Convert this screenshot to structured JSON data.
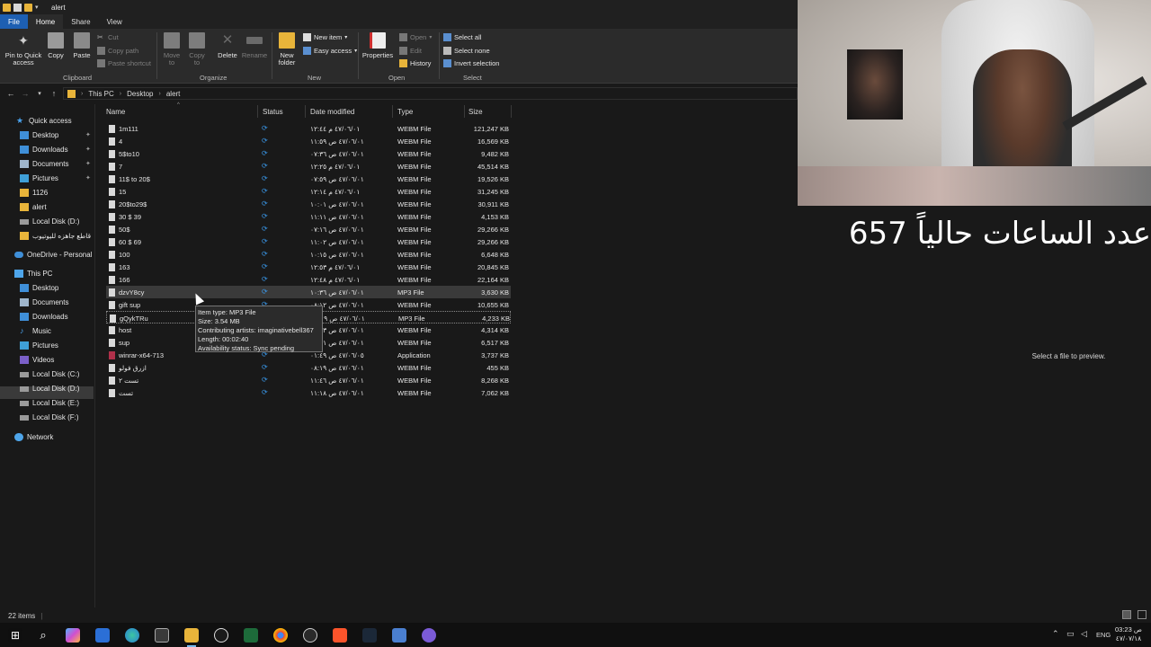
{
  "window": {
    "title": "alert"
  },
  "tabs": [
    "File",
    "Home",
    "Share",
    "View"
  ],
  "ribbon": {
    "clipboard": {
      "pin": "Pin to Quick access",
      "copy": "Copy",
      "paste": "Paste",
      "cut": "Cut",
      "copy_path": "Copy path",
      "paste_shortcut": "Paste shortcut",
      "group": "Clipboard"
    },
    "organize": {
      "move_to": "Move to",
      "copy_to": "Copy to",
      "delete": "Delete",
      "rename": "Rename",
      "group": "Organize"
    },
    "new": {
      "new_folder": "New folder",
      "new_item": "New item",
      "easy_access": "Easy access",
      "group": "New"
    },
    "open": {
      "properties": "Properties",
      "open": "Open",
      "edit": "Edit",
      "history": "History",
      "group": "Open"
    },
    "select": {
      "select_all": "Select all",
      "select_none": "Select none",
      "invert": "Invert selection",
      "group": "Select"
    }
  },
  "breadcrumbs": [
    "This PC",
    "Desktop",
    "alert"
  ],
  "nav": {
    "quick_access": "Quick access",
    "quick_items": [
      "Desktop",
      "Downloads",
      "Documents",
      "Pictures",
      "1126",
      "alert",
      "Local Disk (D:)",
      "قاطع جاهزه لليوتيوب"
    ],
    "onedrive": "OneDrive - Personal",
    "this_pc": "This PC",
    "pc_items": [
      "Desktop",
      "Documents",
      "Downloads",
      "Music",
      "Pictures",
      "Videos",
      "Local Disk (C:)",
      "Local Disk (D:)",
      "Local Disk (E:)",
      "Local Disk (F:)"
    ],
    "network": "Network"
  },
  "columns": {
    "name": "Name",
    "status": "Status",
    "date": "Date modified",
    "type": "Type",
    "size": "Size"
  },
  "files": [
    {
      "name": "1m111",
      "date": "٤٧/٠٦/٠١ م ١٢:٤٤",
      "type": "WEBM File",
      "size": "121,247 KB"
    },
    {
      "name": "4",
      "date": "٤٧/٠٦/٠١ ص ١١:٥٩",
      "type": "WEBM File",
      "size": "16,569 KB"
    },
    {
      "name": "5$to10",
      "date": "٤٧/٠٦/٠١ ص ٠٧:٣٦",
      "type": "WEBM File",
      "size": "9,482 KB"
    },
    {
      "name": "7",
      "date": "٤٧/٠٦/٠١ م ١٢:٢٥",
      "type": "WEBM File",
      "size": "45,514 KB"
    },
    {
      "name": "11$ to 20$",
      "date": "٤٧/٠٦/٠١ ص ٠٧:٥٩",
      "type": "WEBM File",
      "size": "19,526 KB"
    },
    {
      "name": "15",
      "date": "٤٧/٠٦/٠١ م ١٢:١٤",
      "type": "WEBM File",
      "size": "31,245 KB"
    },
    {
      "name": "20$to29$",
      "date": "٤٧/٠٦/٠١ ص ١٠:٠١",
      "type": "WEBM File",
      "size": "30,911 KB"
    },
    {
      "name": "30 $ 39",
      "date": "٤٧/٠٦/٠١ ص ١١:١١",
      "type": "WEBM File",
      "size": "4,153 KB"
    },
    {
      "name": "50$",
      "date": "٤٧/٠٦/٠١ ص ٠٧:١٦",
      "type": "WEBM File",
      "size": "29,266 KB"
    },
    {
      "name": "60 $ 69",
      "date": "٤٧/٠٦/٠١ ص ١١:٠٢",
      "type": "WEBM File",
      "size": "29,266 KB"
    },
    {
      "name": "100",
      "date": "٤٧/٠٦/٠١ ص ١٠:١٥",
      "type": "WEBM File",
      "size": "6,648 KB"
    },
    {
      "name": "163",
      "date": "٤٧/٠٦/٠١ م ١٢:٥٣",
      "type": "WEBM File",
      "size": "20,845 KB"
    },
    {
      "name": "166",
      "date": "٤٧/٠٦/٠١ م ١٢:٤٨",
      "type": "WEBM File",
      "size": "22,164 KB"
    },
    {
      "name": "dzvY8cy",
      "date": "٤٧/٠٦/٠١ ص ١٠:٣٦",
      "type": "MP3 File",
      "size": "3,630 KB"
    },
    {
      "name": "gift sup",
      "date": "٤٧/٠٦/٠١ ص ٠٨:١٢",
      "type": "WEBM File",
      "size": "10,655 KB"
    },
    {
      "name": "gQykTRu",
      "date": "٤٧/٠٦/٠١ ص ١٠:٠٩",
      "type": "MP3 File",
      "size": "4,233 KB"
    },
    {
      "name": "host",
      "date": "٤٧/٠٦/٠١ ص ٠٨:١٣",
      "type": "WEBM File",
      "size": "4,314 KB"
    },
    {
      "name": "sup",
      "date": "٤٧/٠٦/٠١ ص ٠٨:١١",
      "type": "WEBM File",
      "size": "6,517 KB"
    },
    {
      "name": "winrar-x64-713",
      "date": "٤٧/٠٦/٠٥ ص ٠١:٤٩",
      "type": "Application",
      "size": "3,737 KB"
    },
    {
      "name": "ازرق فولو",
      "date": "٤٧/٠٦/٠١ ص ٠٨:١٩",
      "type": "WEBM File",
      "size": "455 KB"
    },
    {
      "name": "تست ٢",
      "date": "٤٧/٠٦/٠١ ص ١١:٤٦",
      "type": "WEBM File",
      "size": "8,268 KB"
    },
    {
      "name": "تست",
      "date": "٤٧/٠٦/٠١ ص ١١:١٨",
      "type": "WEBM File",
      "size": "7,062 KB"
    }
  ],
  "tooltip": {
    "type": "Item type: MP3 File",
    "size": "Size: 3.54 MB",
    "artists": "Contributing artists: imaginativebell367",
    "length": "Length: 00:02:40",
    "availability": "Availability status: Sync pending"
  },
  "preview": {
    "text": "Select a file to preview."
  },
  "status": {
    "count": "22 items"
  },
  "overlay": {
    "hours_text": "عدد الساعات حالياً 657"
  },
  "taskbar": {
    "lang": "ENG",
    "time": "03:23 ص",
    "date": "٤٧/٠٧/١٨"
  },
  "colors": {
    "accent": "#1d5fb2",
    "sync": "#3a9bef",
    "background": "#191919"
  }
}
